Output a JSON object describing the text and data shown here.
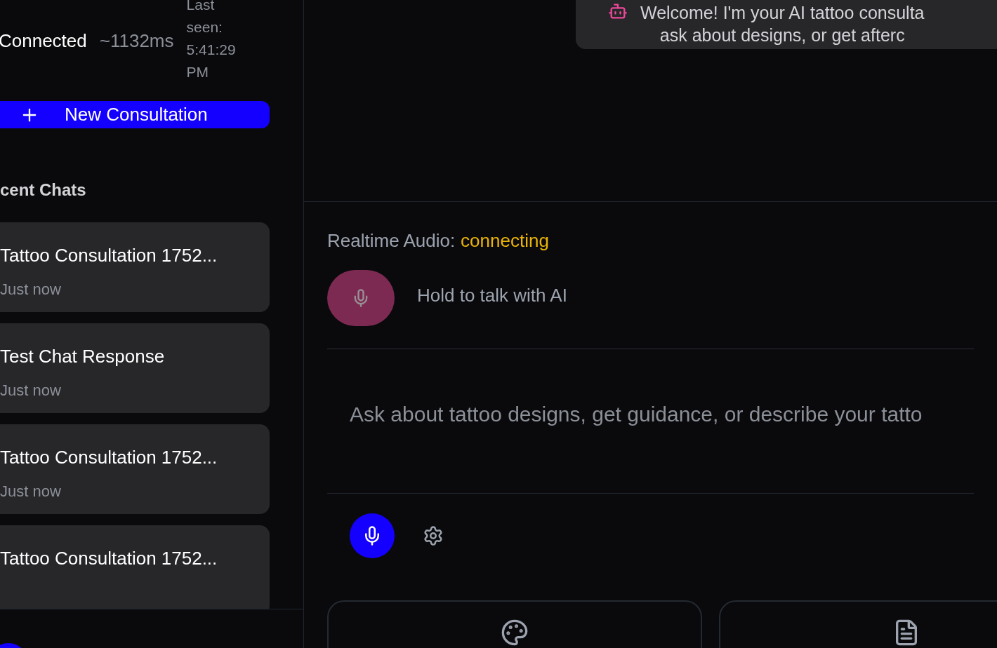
{
  "sidebar": {
    "status": {
      "label": "Connected",
      "latency": "~1132ms",
      "last_seen": "Last seen: 5:41:29 PM"
    },
    "new_button": "New Consultation",
    "section_title": "cent Chats",
    "chats": [
      {
        "title": "Tattoo Consultation 1752...",
        "time": "Just now"
      },
      {
        "title": "Test Chat Response",
        "time": "Just now"
      },
      {
        "title": "Tattoo Consultation 1752...",
        "time": "Just now"
      },
      {
        "title": "Tattoo Consultation 1752..."
      }
    ]
  },
  "welcome": {
    "lines": [
      "Welcome! I'm your AI tattoo consulta",
      "ask about designs, or get afterc"
    ]
  },
  "audio": {
    "label": "Realtime Audio:",
    "status": "connecting",
    "hold_text": "Hold to talk with AI"
  },
  "input": {
    "placeholder": "Ask about tattoo designs, get guidance, or describe your tatto"
  },
  "quick_cards": [
    {
      "kind": "palette"
    },
    {
      "kind": "document"
    }
  ]
}
